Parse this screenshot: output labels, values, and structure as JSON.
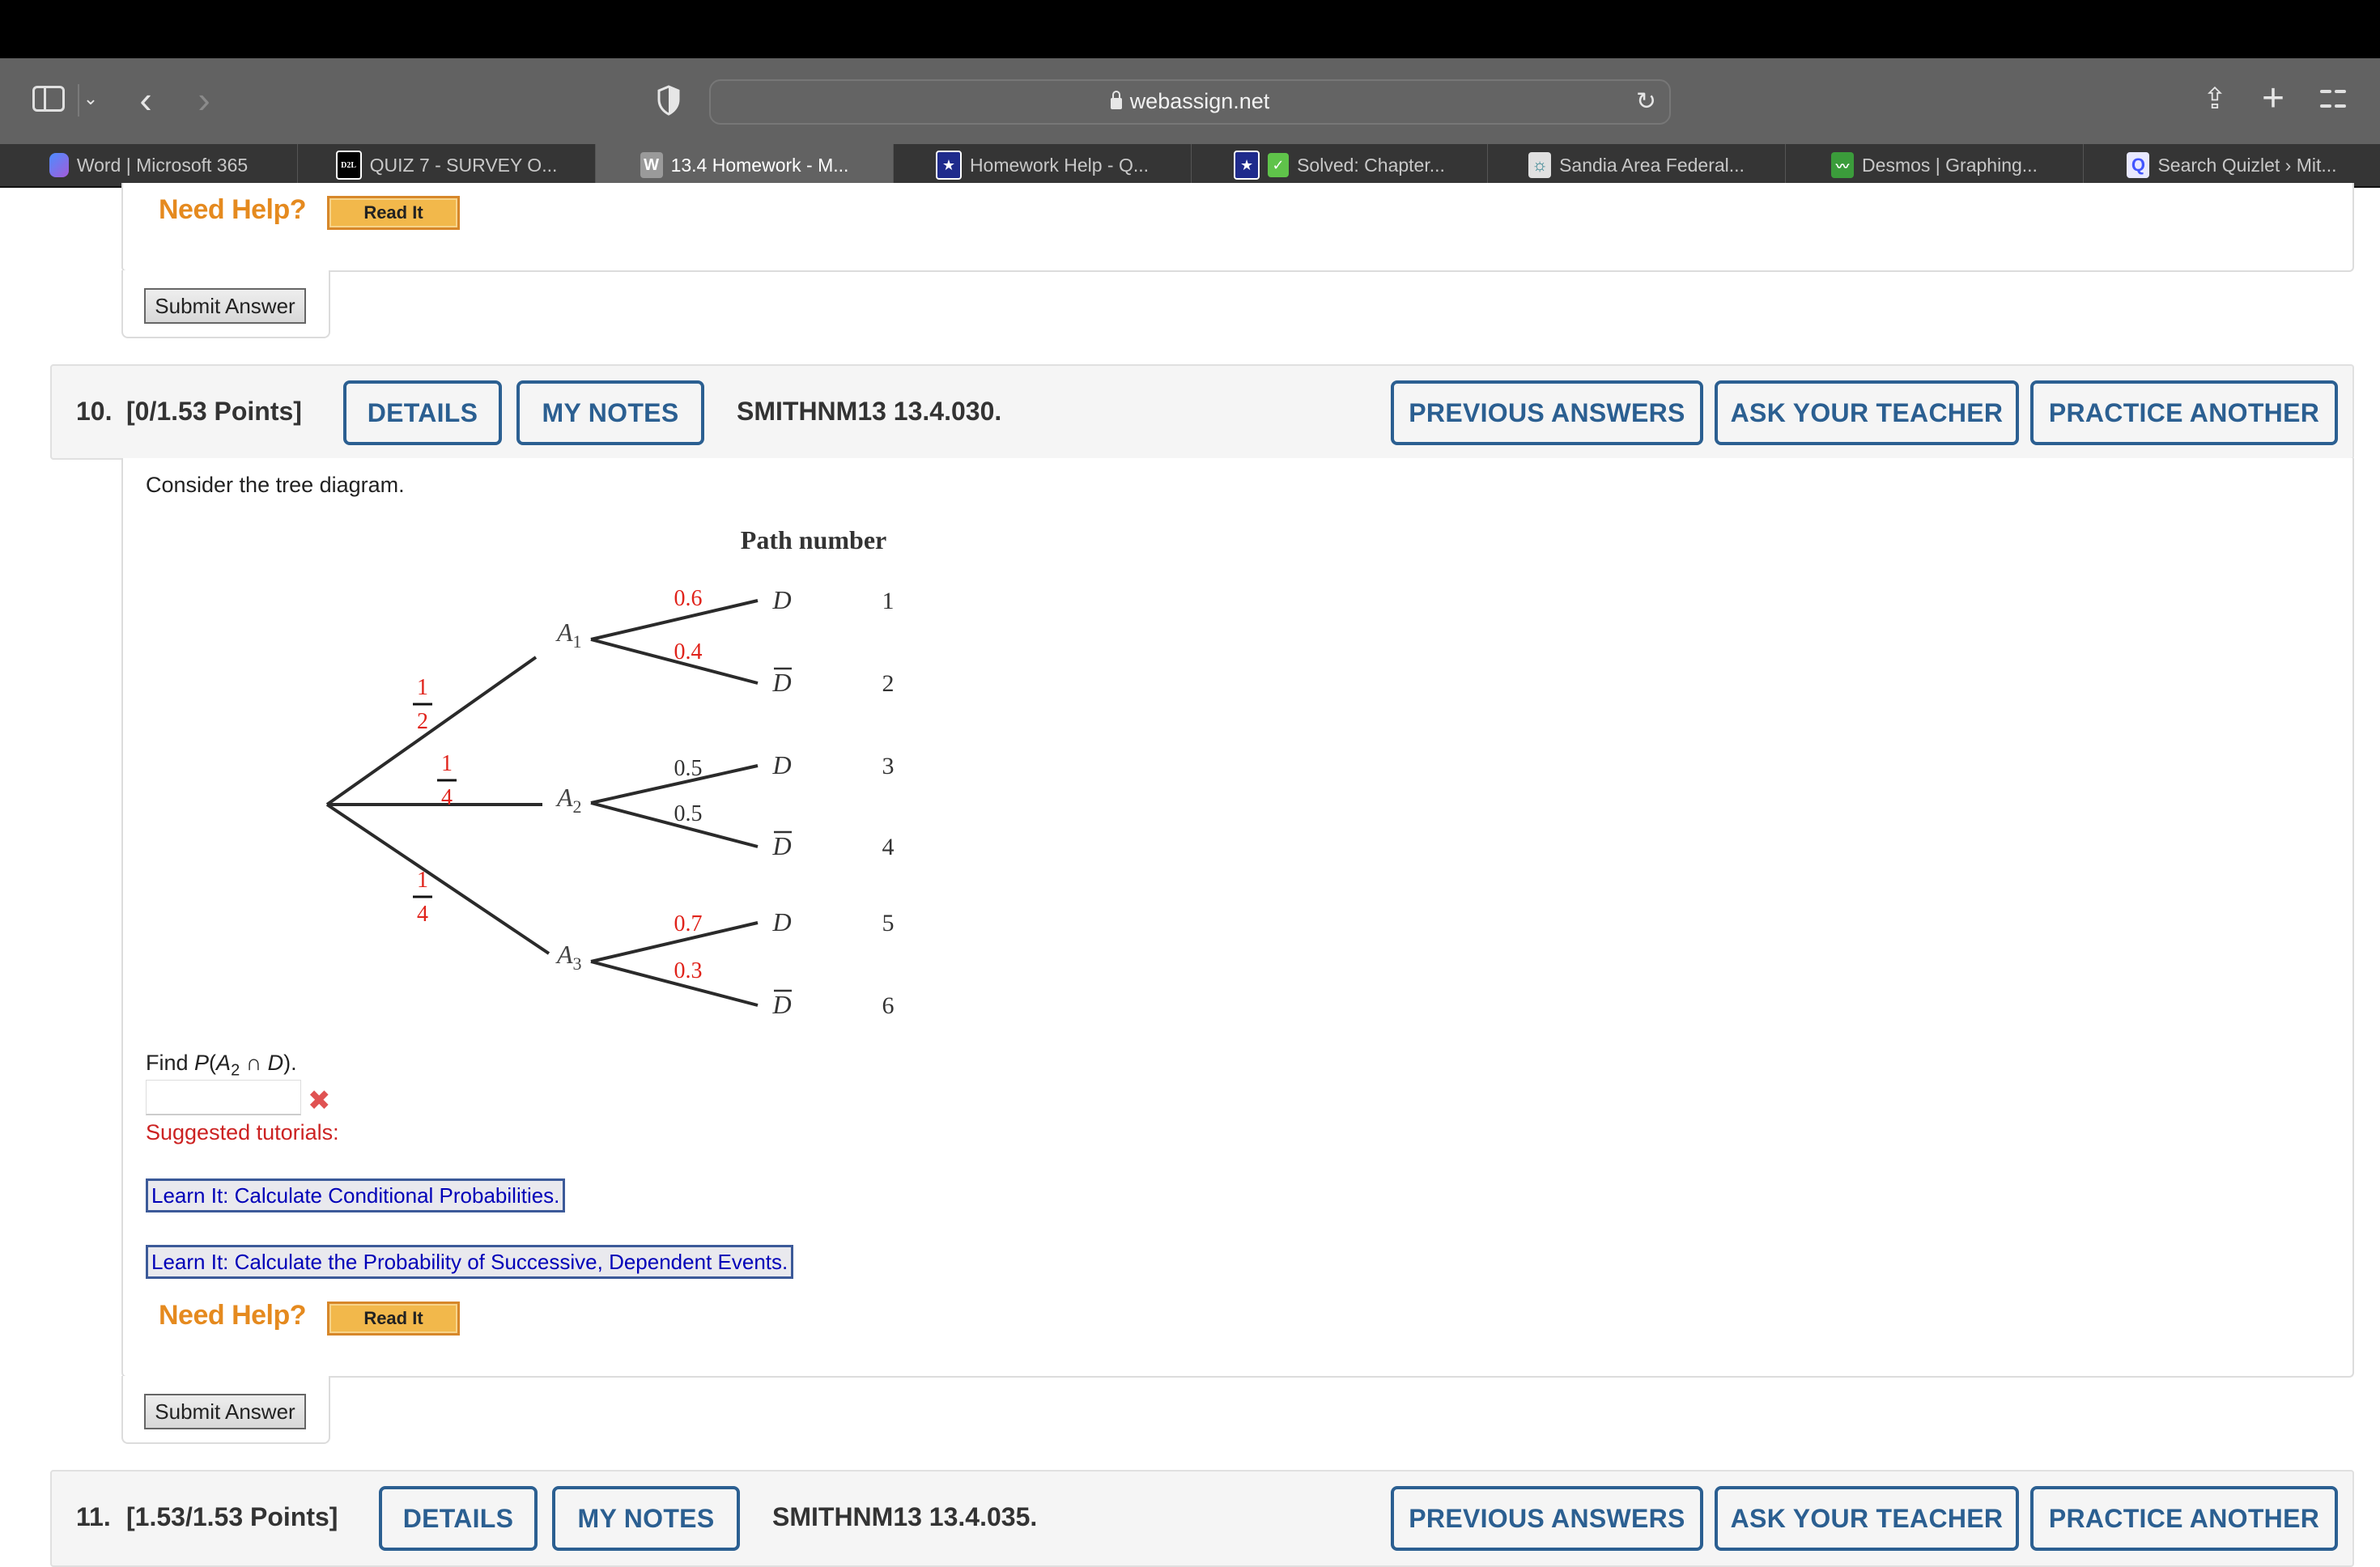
{
  "browser": {
    "url": "webassign.net",
    "tabs": [
      {
        "label": "Word | Microsoft 365",
        "icon": "word-icon",
        "glyph": ""
      },
      {
        "label": "QUIZ 7 - SURVEY O...",
        "icon": "d2l-icon",
        "glyph": "D2L"
      },
      {
        "label": "13.4 Homework - M...",
        "icon": "webassign-icon",
        "glyph": "W",
        "active": true
      },
      {
        "label": "Homework Help - Q...",
        "icon": "star-icon",
        "glyph": "★"
      },
      {
        "label": "Solved: Chapter...",
        "icon": "star-icon",
        "glyph": "★",
        "glyph2": "✓"
      },
      {
        "label": "Sandia Area Federal...",
        "icon": "zia-icon",
        "glyph": "☼"
      },
      {
        "label": "Desmos | Graphing...",
        "icon": "desmos-icon",
        "glyph": "〰"
      },
      {
        "label": "Search Quizlet › Mit...",
        "icon": "quizlet-icon",
        "glyph": "Q"
      }
    ],
    "glyphs": {
      "back": "‹",
      "forward": "›",
      "chevron_down": "⌄",
      "reload": "↻",
      "share": "⇪",
      "plus": "+"
    }
  },
  "prev_question": {
    "need_help": "Need Help?",
    "read_it": "Read It",
    "submit": "Submit Answer"
  },
  "question10": {
    "number": "10.",
    "points": "[0/1.53 Points]",
    "details": "DETAILS",
    "my_notes": "MY NOTES",
    "code": "SMITHNM13 13.4.030.",
    "previous_answers": "PREVIOUS ANSWERS",
    "ask_teacher": "ASK YOUR TEACHER",
    "practice_another": "PRACTICE ANOTHER",
    "prompt": "Consider the tree diagram.",
    "tree": {
      "path_header": "Path number",
      "first_level": [
        {
          "label": "A",
          "sub": "1",
          "prob_num": "1",
          "prob_den": "2",
          "prob_color": "#e0231b"
        },
        {
          "label": "A",
          "sub": "2",
          "prob_num": "1",
          "prob_den": "4",
          "prob_color": "#e0231b"
        },
        {
          "label": "A",
          "sub": "3",
          "prob_num": "1",
          "prob_den": "4",
          "prob_color": "#e0231b"
        }
      ],
      "second_level": [
        {
          "parent": "A1",
          "outcome": "D",
          "bar": false,
          "prob": "0.6",
          "prob_color": "#e0231b",
          "path": "1"
        },
        {
          "parent": "A1",
          "outcome": "D",
          "bar": true,
          "prob": "0.4",
          "prob_color": "#e0231b",
          "path": "2"
        },
        {
          "parent": "A2",
          "outcome": "D",
          "bar": false,
          "prob": "0.5",
          "prob_color": "#333333",
          "path": "3"
        },
        {
          "parent": "A2",
          "outcome": "D",
          "bar": true,
          "prob": "0.5",
          "prob_color": "#333333",
          "path": "4"
        },
        {
          "parent": "A3",
          "outcome": "D",
          "bar": false,
          "prob": "0.7",
          "prob_color": "#e0231b",
          "path": "5"
        },
        {
          "parent": "A3",
          "outcome": "D",
          "bar": true,
          "prob": "0.3",
          "prob_color": "#e0231b",
          "path": "6"
        }
      ]
    },
    "find_prefix": "Find ",
    "find_P": "P",
    "find_A": "A",
    "find_sub": "2",
    "find_cap": " ∩ ",
    "find_D": "D",
    "find_suffix": ").",
    "find_open": "(",
    "answer_value": "",
    "answer_status": "incorrect",
    "x_mark": "✖",
    "suggested": "Suggested tutorials:",
    "tutorials": [
      "Learn It: Calculate Conditional Probabilities.",
      "Learn It: Calculate the Probability of Successive, Dependent Events."
    ],
    "need_help": "Need Help?",
    "read_it": "Read It",
    "submit": "Submit Answer"
  },
  "question11": {
    "number": "11.",
    "points": "[1.53/1.53 Points]",
    "details": "DETAILS",
    "my_notes": "MY NOTES",
    "code": "SMITHNM13 13.4.035.",
    "previous_answers": "PREVIOUS ANSWERS",
    "ask_teacher": "ASK YOUR TEACHER",
    "practice_another": "PRACTICE ANOTHER"
  }
}
